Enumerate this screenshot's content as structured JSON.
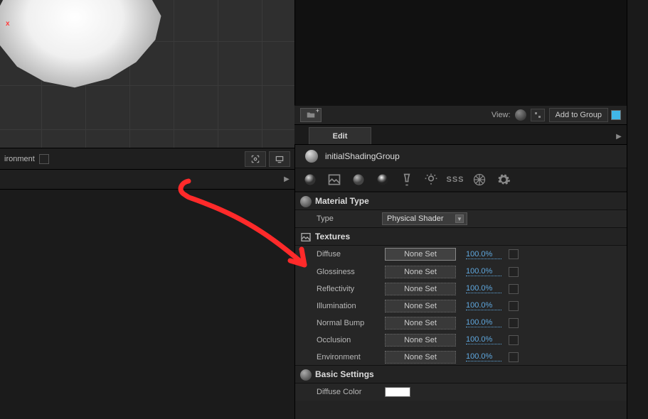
{
  "viewport": {
    "env_label": "ironment",
    "gizmo_x": "x"
  },
  "preview_toolbar": {
    "view_label": "View:",
    "add_to_group": "Add to Group"
  },
  "tabs": {
    "edit": "Edit"
  },
  "material": {
    "name": "initialShadingGroup"
  },
  "iconbar": {
    "i0": "sphere-shaded-icon",
    "i1": "image-icon",
    "i2": "sphere-grey-icon",
    "i3": "sphere-chrome-icon",
    "i4": "glass-icon",
    "i5": "light-icon",
    "i6": "sss-icon",
    "sss_text": "SSS",
    "i7": "geodesic-icon",
    "i8": "gear-icon"
  },
  "sections": {
    "material_type": {
      "title": "Material Type",
      "type_label": "Type",
      "type_value": "Physical Shader"
    },
    "textures": {
      "title": "Textures",
      "rows": [
        {
          "label": "Diffuse",
          "btn": "None Set",
          "pct": "100.0%",
          "highlight": true
        },
        {
          "label": "Glossiness",
          "btn": "None Set",
          "pct": "100.0%",
          "highlight": false
        },
        {
          "label": "Reflectivity",
          "btn": "None Set",
          "pct": "100.0%",
          "highlight": false
        },
        {
          "label": "Illumination",
          "btn": "None Set",
          "pct": "100.0%",
          "highlight": false
        },
        {
          "label": "Normal Bump",
          "btn": "None Set",
          "pct": "100.0%",
          "highlight": false
        },
        {
          "label": "Occlusion",
          "btn": "None Set",
          "pct": "100.0%",
          "highlight": false
        },
        {
          "label": "Environment",
          "btn": "None Set",
          "pct": "100.0%",
          "highlight": false
        }
      ]
    },
    "basic": {
      "title": "Basic Settings",
      "diffuse_color_label": "Diffuse Color",
      "diffuse_color_value": "#ffffff"
    }
  }
}
